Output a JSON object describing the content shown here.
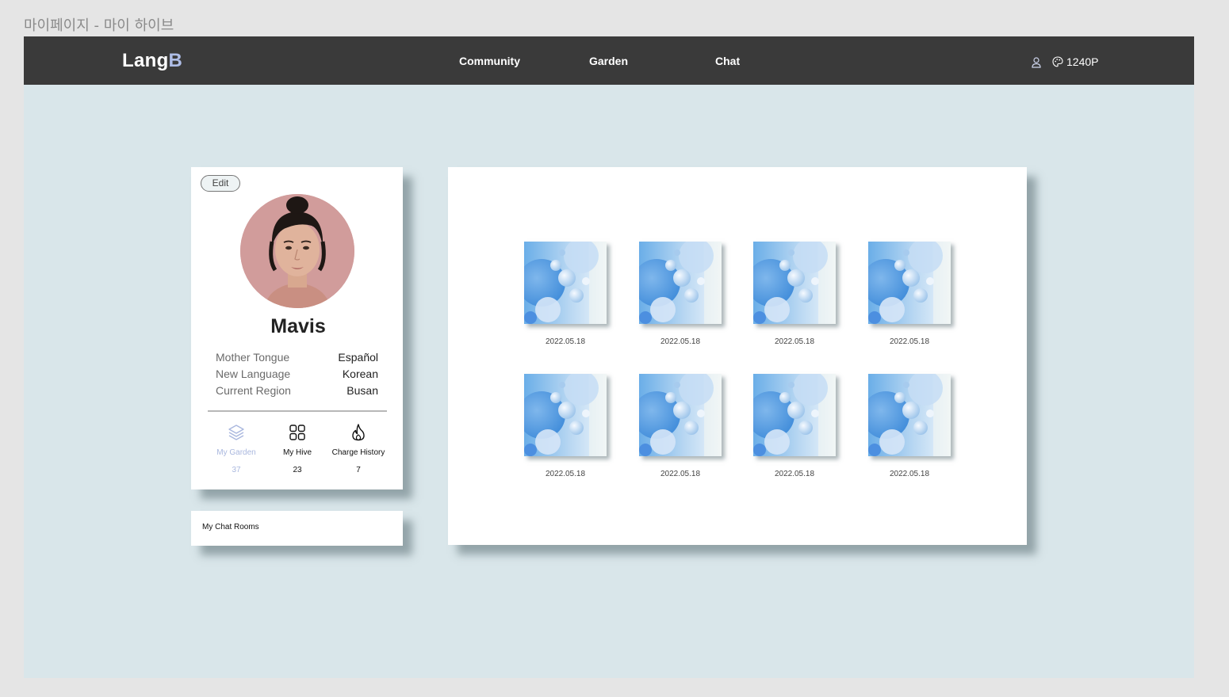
{
  "frame_title": "마이페이지 - 마이 하이브",
  "nav": {
    "logo_main": "Lang",
    "logo_accent": "B",
    "links": [
      "Community",
      "Garden",
      "Chat"
    ],
    "points": "1240P"
  },
  "profile": {
    "edit_label": "Edit",
    "name": "Mavis",
    "info": [
      {
        "label": "Mother Tongue",
        "value": "Español"
      },
      {
        "label": "New Language",
        "value": "Korean"
      },
      {
        "label": "Current Region",
        "value": "Busan"
      }
    ],
    "stats": [
      {
        "label": "My Garden",
        "count": "37",
        "icon": "layers-icon"
      },
      {
        "label": "My Hive",
        "count": "23",
        "icon": "grid-icon"
      },
      {
        "label": "Charge History",
        "count": "7",
        "icon": "flame-icon"
      }
    ]
  },
  "chat_rooms_label": "My Chat Rooms",
  "gallery": {
    "items": [
      {
        "date": "2022.05.18"
      },
      {
        "date": "2022.05.18"
      },
      {
        "date": "2022.05.18"
      },
      {
        "date": "2022.05.18"
      },
      {
        "date": "2022.05.18"
      },
      {
        "date": "2022.05.18"
      },
      {
        "date": "2022.05.18"
      },
      {
        "date": "2022.05.18"
      }
    ]
  },
  "colors": {
    "nav_bg": "#3a3a3a",
    "frame_bg": "#d9e6ea",
    "accent": "#aebde6"
  }
}
